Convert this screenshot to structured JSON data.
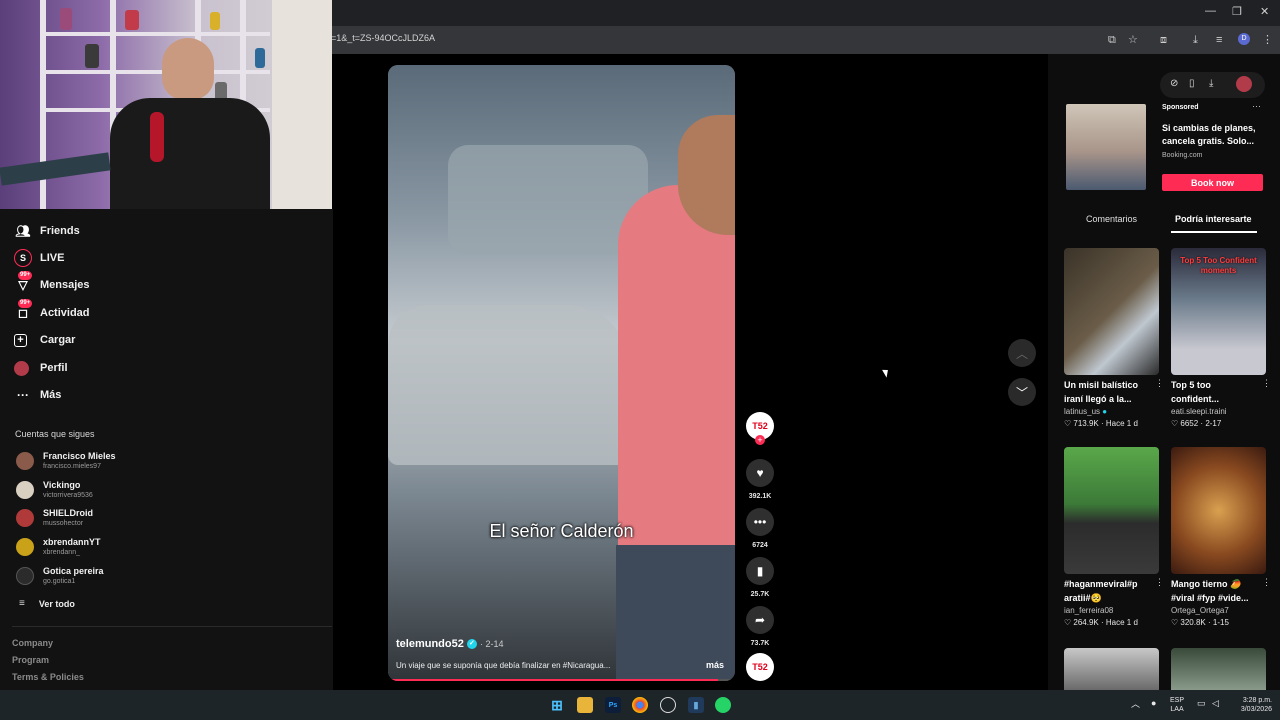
{
  "browser": {
    "url": "=1&_t=ZS-94OCcJLDZ6A",
    "profile_initial": "D"
  },
  "sidebar": {
    "nav": [
      {
        "label": "Friends",
        "icon": "friends-icon"
      },
      {
        "label": "LIVE",
        "icon": "live-icon"
      },
      {
        "label": "Mensajes",
        "icon": "messages-icon",
        "badge": "99+"
      },
      {
        "label": "Actividad",
        "icon": "activity-icon",
        "badge": "99+"
      },
      {
        "label": "Cargar",
        "icon": "upload-icon"
      },
      {
        "label": "Perfil",
        "icon": "profile-icon"
      },
      {
        "label": "Más",
        "icon": "more-icon"
      }
    ],
    "following_title": "Cuentas que sigues",
    "accounts": [
      {
        "name": "Francisco Mieles",
        "user": "francisco.mieles97",
        "color": "#8a5a4a"
      },
      {
        "name": "Vickingo",
        "user": "victorrivera9536",
        "color": "#d9d0c2"
      },
      {
        "name": "SHIELDroid",
        "user": "mussohector",
        "color": "#b03a3a"
      },
      {
        "name": "xbrendannYT",
        "user": "xbrendann_",
        "color": "#c9a21a"
      },
      {
        "name": "Gotica pereira",
        "user": "go.gotica1",
        "color": "#2b2b2b"
      }
    ],
    "see_all": "Ver todo",
    "footer": [
      "Company",
      "Program",
      "Terms & Policies"
    ]
  },
  "video": {
    "subtitle": "El señor Calderón",
    "author": "telemundo52",
    "date": "· 2-14",
    "caption": "Un viaje que se suponía que debía finalizar en #Nicaragua...",
    "more": "más",
    "progress": 0.95
  },
  "actions": {
    "likes": "392.1K",
    "comments": "6724",
    "saves": "25.7K",
    "shares": "73.7K",
    "channel_badge": "T52"
  },
  "right_panel": {
    "ad": {
      "sponsored": "Sponsored",
      "text": "Si cambias de planes, cancela gratis. Solo...",
      "domain": "Booking.com",
      "cta": "Book now"
    },
    "tabs": [
      "Comentarios",
      "Podría interesarte"
    ],
    "cards": [
      {
        "title": "Un misil balístico iraní llegó a la...",
        "user": "latinus_us",
        "views": "713.9K",
        "age": "Hace 1 d",
        "verified": true
      },
      {
        "title": "Top 5 too confident...",
        "user": "eati.sleepi.traini",
        "views": "6652",
        "age": "2-17",
        "overlay": "Top 5 Too Confident moments"
      },
      {
        "title": "#haganmeviral#p aratii#🥺",
        "user": "ian_ferreira08",
        "views": "264.9K",
        "age": "Hace 1 d"
      },
      {
        "title": "Mango tierno 🥭 #viral #fyp #vide...",
        "user": "Ortega_Ortega7",
        "views": "320.8K",
        "age": "1-15"
      }
    ]
  },
  "taskbar": {
    "lang": "ESP",
    "lang2": "LAA",
    "time": "3:28 p.m.",
    "date": "3/03/2026"
  }
}
